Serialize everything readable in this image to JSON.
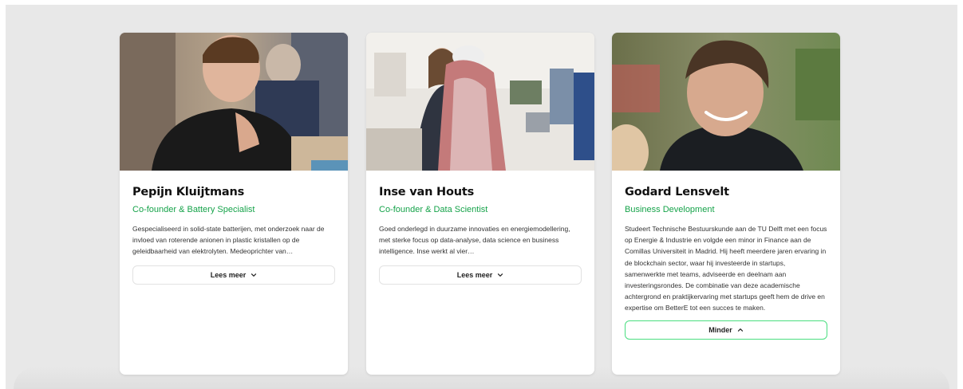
{
  "members": [
    {
      "name": "Pepijn Kluijtmans",
      "role": "Co-founder & Battery Specialist",
      "bio": "Gespecialiseerd in solid-state batterijen, met onderzoek naar de invloed van roterende anionen in plastic kristallen op de geleidbaarheid van elektrolyten. Medeoprichter van…",
      "button_label": "Lees meer",
      "button_icon": "chevron-down-icon",
      "expanded": false
    },
    {
      "name": "Inse van Houts",
      "role": "Co-founder & Data Scientist",
      "bio": "Goed onderlegd in duurzame innovaties en energiemodellering, met sterke focus op data-analyse, data science en business intelligence. Inse werkt al vier…",
      "button_label": "Lees meer",
      "button_icon": "chevron-down-icon",
      "expanded": false
    },
    {
      "name": "Godard Lensvelt",
      "role": "Business Development",
      "bio": "Studeert Technische Bestuurskunde aan de TU Delft met een focus op Energie & Industrie en volgde een minor in Finance aan de Comillas Universiteit in Madrid. Hij heeft meerdere jaren ervaring in de blockchain sector, waar hij investeerde in startups, samenwerkte met teams, adviseerde en deelnam aan investeringsrondes. De combinatie van deze academische achtergrond en praktijkervaring met startups geeft hem de drive en expertise om BetterE tot een succes te maken.",
      "button_label": "Minder",
      "button_icon": "chevron-up-icon",
      "expanded": true
    }
  ],
  "colors": {
    "accent": "#16a34a",
    "button_border_open": "#4ade80",
    "background": "#e8e8e8"
  }
}
